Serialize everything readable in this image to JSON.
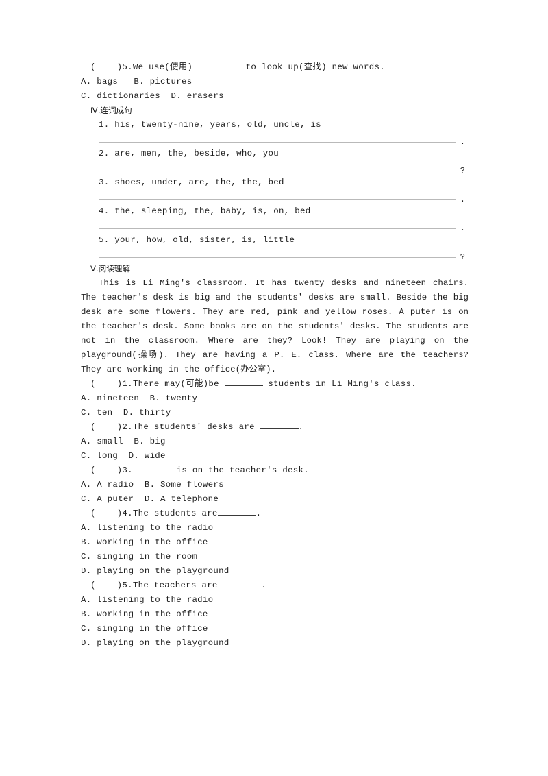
{
  "document": {
    "type": "english-workbook-page",
    "language": "zh-CN/en"
  },
  "top_question": {
    "marker": "(    )5.",
    "stem_before": "We use(使用) ",
    "stem_after": " to look up(查找) new words.",
    "options_line1": "A. bags   B. pictures",
    "options_line2": "C. dictionaries  D. erasers"
  },
  "section_four": {
    "heading": "Ⅳ.连词成句",
    "items": [
      {
        "prompt": "1. his, twenty-nine, years, old, uncle, is",
        "end_punctuation": "."
      },
      {
        "prompt": "2. are, men, the, beside, who, you",
        "end_punctuation": "?"
      },
      {
        "prompt": "3. shoes, under, are, the, the, bed",
        "end_punctuation": "."
      },
      {
        "prompt": "4. the, sleeping, the, baby, is, on, bed",
        "end_punctuation": "."
      },
      {
        "prompt": "5. your, how, old, sister, is, little",
        "end_punctuation": "?"
      }
    ]
  },
  "section_five": {
    "heading": "Ⅴ.阅读理解",
    "passage": "This is Li Ming's classroom. It has twenty desks and nineteen chairs. The teacher's desk is big and the students' desks are small. Beside the big desk are some flowers. They are red, pink and yellow roses. A puter is on the teacher's desk. Some books are on the students' desks. The students are not in the classroom. Where are they? Look! They are playing on the playground(操场). They are having a P. E. class. Where are the teachers? They are working in the office(办公室).",
    "questions": [
      {
        "marker": "(    )1.",
        "stem_before": "There may(可能)be ",
        "stem_after": " students in Li Ming's class.",
        "options": [
          "A. nineteen  B. twenty",
          "C. ten  D. thirty"
        ]
      },
      {
        "marker": "(    )2.",
        "stem_before": "The students' desks are ",
        "stem_after": ".",
        "options": [
          "A. small  B. big",
          "C. long  D. wide"
        ]
      },
      {
        "marker": "(    )3.",
        "stem_before": "",
        "stem_after": " is on the teacher's desk.",
        "options": [
          "A. A radio  B. Some flowers",
          "C. A puter  D. A telephone"
        ]
      },
      {
        "marker": "(    )4.",
        "stem_before": "The students are",
        "stem_after": ".",
        "options": [
          "A. listening to the radio",
          "B. working in the office",
          "C. singing in the room",
          "D. playing on the playground"
        ]
      },
      {
        "marker": "(    )5.",
        "stem_before": "The teachers are ",
        "stem_after": ".",
        "options": [
          "A. listening to the radio",
          "B. working in the office",
          "C. singing in the office",
          "D. playing on the playground"
        ]
      }
    ]
  }
}
